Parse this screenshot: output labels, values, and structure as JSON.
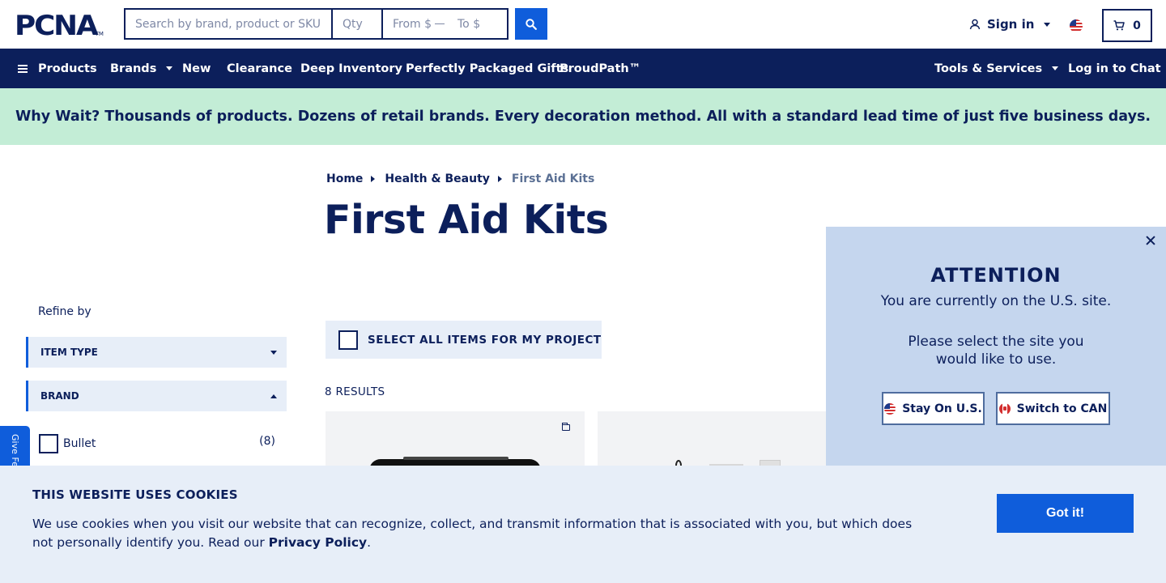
{
  "header": {
    "logo": "PCNA",
    "logo_tm": "TM",
    "search_placeholder": "Search by brand, product or SKU",
    "qty_placeholder": "Qty",
    "price_from_placeholder": "From $",
    "price_to_placeholder": "To $",
    "signin_label": "Sign in",
    "cart_count": "0"
  },
  "nav": {
    "products": "Products",
    "brands": "Brands",
    "new": "New",
    "clearance": "Clearance",
    "deep_inventory": "Deep Inventory",
    "gifts": "Perfectly Packaged Gifts",
    "proudpath": "ProudPath™",
    "tools": "Tools & Services",
    "chat": "Log in to Chat"
  },
  "promo": {
    "text": "Why Wait? Thousands of products. Dozens of retail brands. Every decoration method. All with a standard lead time of just five business days."
  },
  "breadcrumb": {
    "home": "Home",
    "category": "Health & Beauty",
    "current": "First Aid Kits"
  },
  "page_title": "First Aid Kits",
  "sidebar": {
    "refine_label": "Refine by",
    "facets": [
      {
        "label": "ITEM TYPE",
        "expanded": false
      },
      {
        "label": "BRAND",
        "expanded": true
      }
    ],
    "brand_options": [
      {
        "label": "Bullet",
        "count": "(8)"
      }
    ],
    "feedback_label": "Give Feedback"
  },
  "main": {
    "select_all_label": "SELECT ALL ITEMS FOR MY PROJECT",
    "results_label": "8 RESULTS"
  },
  "attention": {
    "title": "ATTENTION",
    "subtitle": "You are currently on the U.S. site.",
    "message": "Please select the site you would like to use.",
    "stay_label": "Stay On U.S.",
    "switch_label": "Switch to CAN"
  },
  "cookie": {
    "title": "THIS WEBSITE USES COOKIES",
    "text": "We use cookies when you visit our website that can recognize, collect, and transmit information that is associated with you, but which does not personally identify you. Read our ",
    "link": "Privacy Policy",
    "text_end": ".",
    "button": "Got it!"
  },
  "colors": {
    "navy": "#0c1f5b",
    "accent_blue": "#0f5ddb",
    "promo_green": "#c3edd6",
    "panel_blue": "#c5d6ee",
    "light_blue": "#e7eef8"
  }
}
